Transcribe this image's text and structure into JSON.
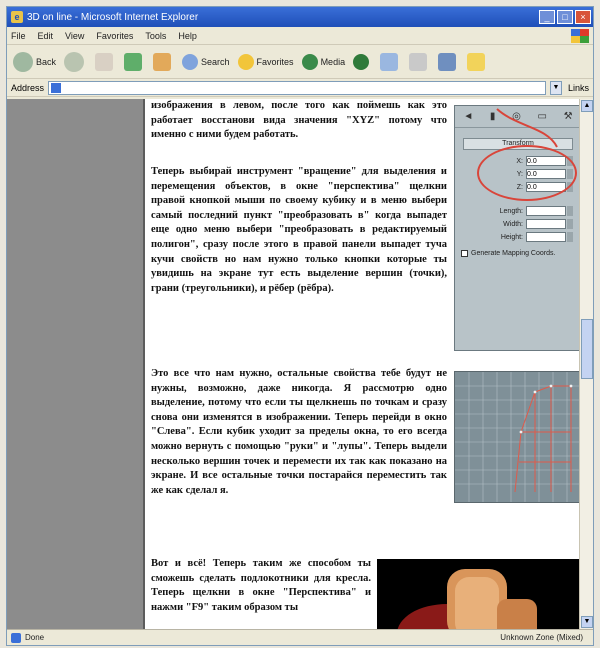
{
  "window": {
    "title": "3D on line - Microsoft Internet Explorer",
    "min": "_",
    "max": "□",
    "close": "×"
  },
  "menu": [
    "File",
    "Edit",
    "View",
    "Favorites",
    "Tools",
    "Help"
  ],
  "toolbar": {
    "back": "Back",
    "search": "Search",
    "favorites": "Favorites",
    "media": "Media"
  },
  "address": {
    "label": "Address",
    "value": "",
    "links": "Links"
  },
  "article": {
    "p1": "изображения в левом, после того как поймешь как это работает восстанови вида значения \"XYZ\" потому что именно с ними будем работать.",
    "p2": "Теперь выбирай инструмент \"вращение\" для выделения и перемещения объектов, в окне \"перспектива\" щелкни правой кнопкой мыши по своему кубику и в меню выбери самый последний пункт \"преобразовать в\" когда выпадет еще одно меню выбери \"преобразовать в редактируемый полигон\", сразу после этого в правой панели выпадет туча кучи свойств но нам нужно только кнопки которые ты увидишь на экране тут есть выделение вершин (точки), грани (треугольники), и рёбер (рёбра).",
    "p3": "Это все что нам нужно, остальные свойства тебе будут не нужны, возможно, даже никогда. Я рассмотрю одно выделение, потому что если ты щелкнешь по точкам и сразу снова они изменятся в изображении. Теперь перейди в окно \"Слева\". Если кубик уходит за пределы окна, то его всегда можно вернуть с помощью \"руки\" и \"лупы\". Теперь выдели несколько вершин точек и перемести их так как показано на экране. И все остальные точки постарайся переместить так же как сделал я.",
    "p4": "Вот и всё! Теперь таким же способом ты сможешь сделать подлокотники для кресла. Теперь щелкни в окне \"Перспектива\" и нажми \"F9\" таким образом ты"
  },
  "panel": {
    "header": "Transform",
    "rows": [
      {
        "label": "X:",
        "value": "0.0"
      },
      {
        "label": "Y:",
        "value": "0.0"
      },
      {
        "label": "Z:",
        "value": "0.0"
      }
    ],
    "rows2": [
      {
        "label": "Length:",
        "value": ""
      },
      {
        "label": "Width:",
        "value": ""
      },
      {
        "label": "Height:",
        "value": ""
      }
    ],
    "checkbox": "Generate Mapping Coords."
  },
  "status": {
    "left": "Done",
    "zone": "Unknown Zone (Mixed)"
  }
}
